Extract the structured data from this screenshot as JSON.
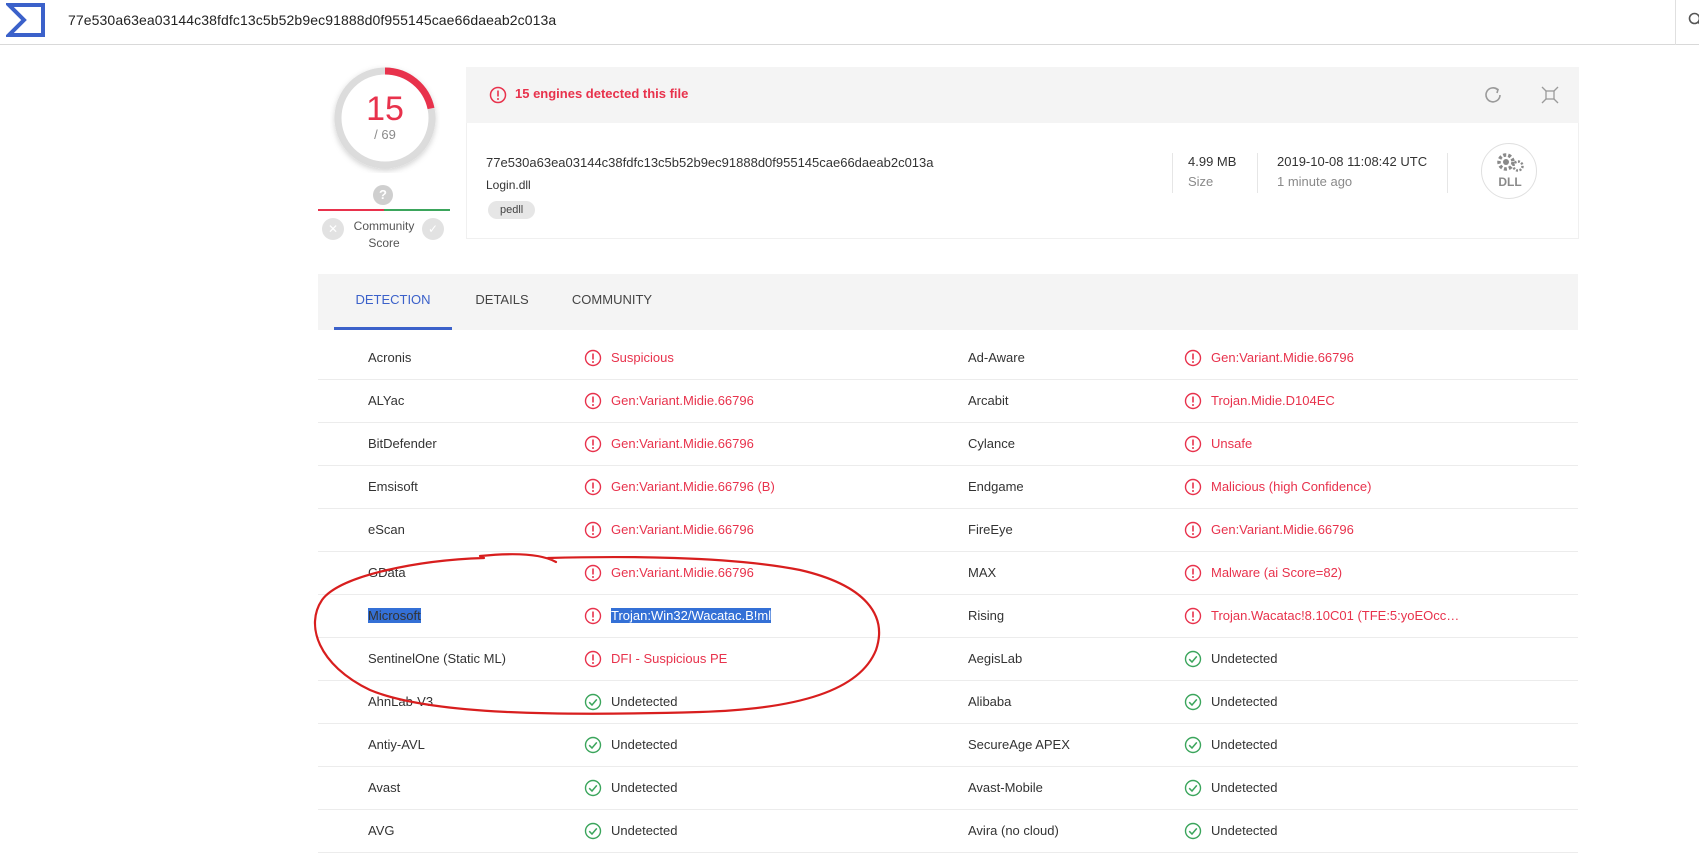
{
  "topbar": {
    "query": "77e530a63ea03144c38fdfc13c5b52b9ec91888d0f955145cae66daeab2c013a"
  },
  "score": {
    "detected": "15",
    "total": "/ 69",
    "detected_fraction": 0.217
  },
  "community": {
    "question_mark": "?",
    "label_line1": "Community",
    "label_line2": "Score"
  },
  "alert": {
    "text": "15 engines detected this file"
  },
  "file": {
    "hash": "77e530a63ea03144c38fdfc13c5b52b9ec91888d0f955145cae66daeab2c013a",
    "name": "Login.dll",
    "tag": "pedll",
    "size_value": "4.99 MB",
    "size_label": "Size",
    "date_value": "2019-10-08 11:08:42 UTC",
    "date_label": "1 minute ago",
    "type_badge": "DLL"
  },
  "tabs": [
    {
      "label": "DETECTION",
      "active": true
    },
    {
      "label": "DETAILS",
      "active": false
    },
    {
      "label": "COMMUNITY",
      "active": false
    }
  ],
  "results": [
    {
      "left": {
        "engine": "Acronis",
        "result": "Suspicious",
        "malicious": true
      },
      "right": {
        "engine": "Ad-Aware",
        "result": "Gen:Variant.Midie.66796",
        "malicious": true
      }
    },
    {
      "left": {
        "engine": "ALYac",
        "result": "Gen:Variant.Midie.66796",
        "malicious": true
      },
      "right": {
        "engine": "Arcabit",
        "result": "Trojan.Midie.D104EC",
        "malicious": true
      }
    },
    {
      "left": {
        "engine": "BitDefender",
        "result": "Gen:Variant.Midie.66796",
        "malicious": true
      },
      "right": {
        "engine": "Cylance",
        "result": "Unsafe",
        "malicious": true
      }
    },
    {
      "left": {
        "engine": "Emsisoft",
        "result": "Gen:Variant.Midie.66796 (B)",
        "malicious": true
      },
      "right": {
        "engine": "Endgame",
        "result": "Malicious (high Confidence)",
        "malicious": true
      }
    },
    {
      "left": {
        "engine": "eScan",
        "result": "Gen:Variant.Midie.66796",
        "malicious": true
      },
      "right": {
        "engine": "FireEye",
        "result": "Gen:Variant.Midie.66796",
        "malicious": true
      }
    },
    {
      "left": {
        "engine": "GData",
        "result": "Gen:Variant.Midie.66796",
        "malicious": true
      },
      "right": {
        "engine": "MAX",
        "result": "Malware (ai Score=82)",
        "malicious": true
      }
    },
    {
      "left": {
        "engine": "Microsoft",
        "result": "Trojan:Win32/Wacatac.B!ml",
        "malicious": true,
        "selected": true
      },
      "right": {
        "engine": "Rising",
        "result": "Trojan.Wacatac!8.10C01 (TFE:5:yoEOcc…",
        "malicious": true
      }
    },
    {
      "left": {
        "engine": "SentinelOne (Static ML)",
        "result": "DFI - Suspicious PE",
        "malicious": true
      },
      "right": {
        "engine": "AegisLab",
        "result": "Undetected",
        "malicious": false
      }
    },
    {
      "left": {
        "engine": "AhnLab-V3",
        "result": "Undetected",
        "malicious": false
      },
      "right": {
        "engine": "Alibaba",
        "result": "Undetected",
        "malicious": false
      }
    },
    {
      "left": {
        "engine": "Antiy-AVL",
        "result": "Undetected",
        "malicious": false
      },
      "right": {
        "engine": "SecureAge APEX",
        "result": "Undetected",
        "malicious": false
      }
    },
    {
      "left": {
        "engine": "Avast",
        "result": "Undetected",
        "malicious": false
      },
      "right": {
        "engine": "Avast-Mobile",
        "result": "Undetected",
        "malicious": false
      }
    },
    {
      "left": {
        "engine": "AVG",
        "result": "Undetected",
        "malicious": false
      },
      "right": {
        "engine": "Avira (no cloud)",
        "result": "Undetected",
        "malicious": false
      }
    }
  ],
  "colors": {
    "malicious": "#e8324c",
    "clean": "#3ba55c",
    "accent": "#3b61ca",
    "annotation": "#d81e1e"
  }
}
